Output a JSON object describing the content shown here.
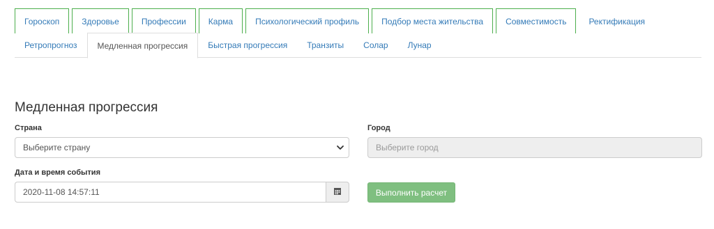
{
  "top_nav": [
    {
      "label": "Гороскоп"
    },
    {
      "label": "Здоровье"
    },
    {
      "label": "Профессии"
    },
    {
      "label": "Карма"
    },
    {
      "label": "Психологический профиль"
    },
    {
      "label": "Подбор места жительства"
    },
    {
      "label": "Совместимость"
    },
    {
      "label": "Ректификация"
    }
  ],
  "sub_nav": [
    {
      "label": "Ретропрогноз"
    },
    {
      "label": "Медленная прогрессия",
      "active": true
    },
    {
      "label": "Быстрая прогрессия"
    },
    {
      "label": "Транзиты"
    },
    {
      "label": "Солар"
    },
    {
      "label": "Лунар"
    }
  ],
  "page_title": "Медленная прогрессия",
  "form": {
    "country_label": "Страна",
    "country_value": "Выберите страну",
    "city_label": "Город",
    "city_placeholder": "Выберите город",
    "datetime_label": "Дата и время события",
    "datetime_value": "2020-11-08 14:57:11",
    "calculate_label": "Выполнить расчет"
  },
  "icons": {
    "select_arrow": "chevron-down-icon",
    "calendar": "calendar-icon"
  },
  "colors": {
    "link": "#337ab7",
    "tab_border": "#4cae4c",
    "button": "#7fbf80"
  }
}
